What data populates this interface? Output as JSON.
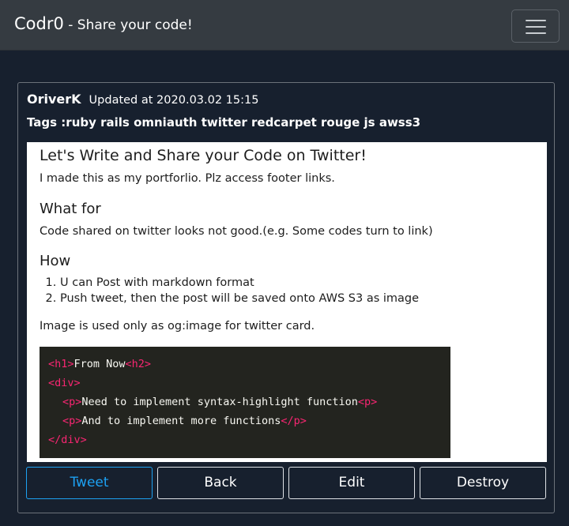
{
  "navbar": {
    "brand": "Codr0",
    "tagline": " - Share your code!",
    "toggler_icon": "hamburger-menu-icon"
  },
  "post": {
    "author": "OriverK",
    "updated": "Updated at 2020.03.02 15:15",
    "tags": "Tags :ruby rails omniauth twitter redcarpet rouge js awss3",
    "content": {
      "h1": "Let's Write and Share your Code on Twitter!",
      "intro": "I made this as my portforlio. Plz access footer links.",
      "what_heading": "What for",
      "what_text": "Code shared on twitter looks not good.(e.g. Some codes turn to link)",
      "how_heading": "How",
      "how_items": [
        "U can Post with markdown format",
        "Push tweet, then the post will be saved onto AWS S3 as image"
      ],
      "note": "Image is used only as og:image for twitter card.",
      "code_lines": [
        {
          "indent": "",
          "open": "<h1>",
          "text": "From Now",
          "close": "<h2>"
        },
        {
          "indent": "",
          "open": "<div>",
          "text": "",
          "close": ""
        },
        {
          "indent": "  ",
          "open": "<p>",
          "text": "Need to implement syntax-highlight function",
          "close": "<p>"
        },
        {
          "indent": "  ",
          "open": "<p>",
          "text": "And to implement more functions",
          "close": "</p>"
        },
        {
          "indent": "",
          "open": "</div>",
          "text": "",
          "close": ""
        }
      ]
    }
  },
  "buttons": {
    "tweet": "Tweet",
    "back": "Back",
    "edit": "Edit",
    "destroy": "Destroy"
  },
  "colors": {
    "background": "#17202e",
    "navbar": "#353b41",
    "tweet_blue": "#1da1f2",
    "code_bg": "#23241f",
    "code_tag": "#f92672"
  }
}
